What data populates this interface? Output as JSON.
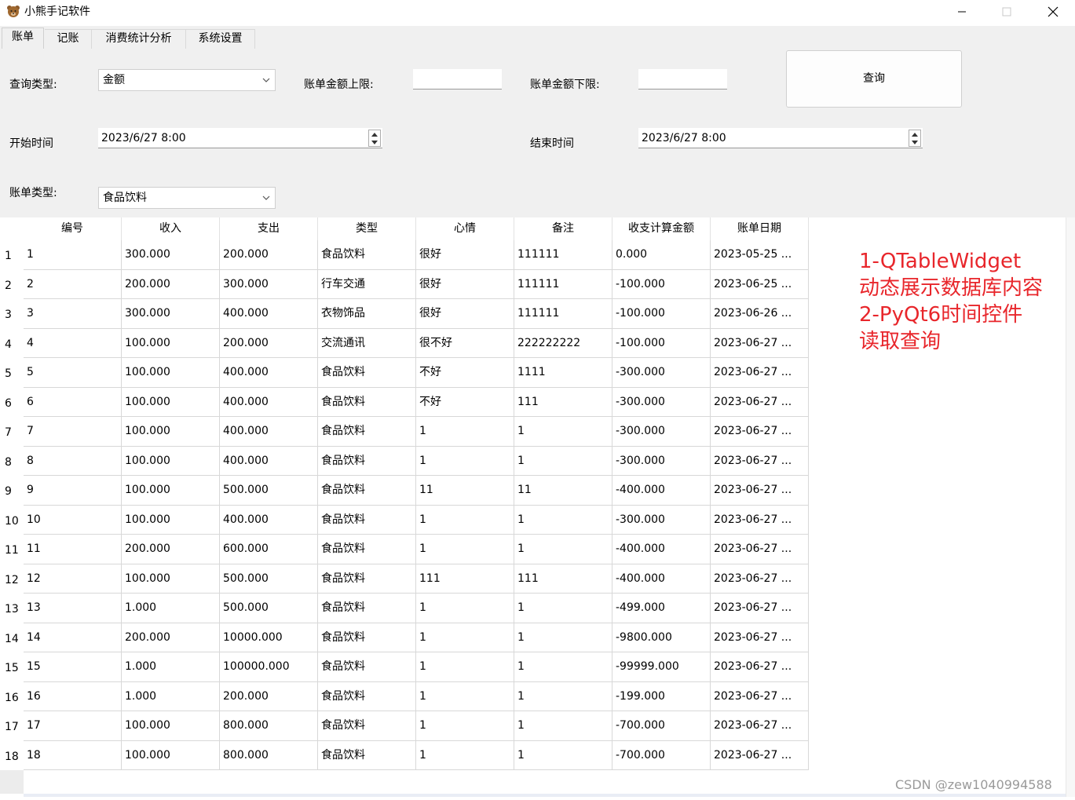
{
  "window": {
    "title": "小熊手记软件",
    "icon": "bear-icon"
  },
  "tabs": [
    {
      "label": "账单",
      "active": true
    },
    {
      "label": "记账",
      "active": false
    },
    {
      "label": "消费统计分析",
      "active": false
    },
    {
      "label": "系统设置",
      "active": false
    }
  ],
  "form": {
    "query_type_label": "查询类型:",
    "query_type_value": "金额",
    "amount_upper_label": "账单金额上限:",
    "amount_upper_value": "",
    "amount_lower_label": "账单金额下限:",
    "amount_lower_value": "",
    "query_button": "查询",
    "start_time_label": "开始时间",
    "start_time_value": "2023/6/27 8:00",
    "end_time_label": "结束时间",
    "end_time_value": "2023/6/27 8:00",
    "bill_type_label": "账单类型:",
    "bill_type_value": "食品饮料"
  },
  "table": {
    "columns": [
      "编号",
      "收入",
      "支出",
      "类型",
      "心情",
      "备注",
      "收支计算金额",
      "账单日期"
    ],
    "rows": [
      [
        "1",
        "1",
        "300.000",
        "200.000",
        "食品饮料",
        "很好",
        "111111",
        "0.000",
        "2023-05-25 ..."
      ],
      [
        "2",
        "2",
        "200.000",
        "300.000",
        "行车交通",
        "很好",
        "111111",
        "-100.000",
        "2023-06-25 ..."
      ],
      [
        "3",
        "3",
        "300.000",
        "400.000",
        "衣物饰品",
        "很好",
        "111111",
        "-100.000",
        "2023-06-26 ..."
      ],
      [
        "4",
        "4",
        "100.000",
        "200.000",
        "交流通讯",
        "很不好",
        "222222222",
        "-100.000",
        "2023-06-27 ..."
      ],
      [
        "5",
        "5",
        "100.000",
        "400.000",
        "食品饮料",
        "不好",
        "1111",
        "-300.000",
        "2023-06-27 ..."
      ],
      [
        "6",
        "6",
        "100.000",
        "400.000",
        "食品饮料",
        "不好",
        "111",
        "-300.000",
        "2023-06-27 ..."
      ],
      [
        "7",
        "7",
        "100.000",
        "400.000",
        "食品饮料",
        "1",
        "1",
        "-300.000",
        "2023-06-27 ..."
      ],
      [
        "8",
        "8",
        "100.000",
        "400.000",
        "食品饮料",
        "1",
        "1",
        "-300.000",
        "2023-06-27 ..."
      ],
      [
        "9",
        "9",
        "100.000",
        "500.000",
        "食品饮料",
        "11",
        "11",
        "-400.000",
        "2023-06-27 ..."
      ],
      [
        "10",
        "10",
        "100.000",
        "400.000",
        "食品饮料",
        "1",
        "1",
        "-300.000",
        "2023-06-27 ..."
      ],
      [
        "11",
        "11",
        "200.000",
        "600.000",
        "食品饮料",
        "1",
        "1",
        "-400.000",
        "2023-06-27 ..."
      ],
      [
        "12",
        "12",
        "100.000",
        "500.000",
        "食品饮料",
        "111",
        "111",
        "-400.000",
        "2023-06-27 ..."
      ],
      [
        "13",
        "13",
        "1.000",
        "500.000",
        "食品饮料",
        "1",
        "1",
        "-499.000",
        "2023-06-27 ..."
      ],
      [
        "14",
        "14",
        "200.000",
        "10000.000",
        "食品饮料",
        "1",
        "1",
        "-9800.000",
        "2023-06-27 ..."
      ],
      [
        "15",
        "15",
        "1.000",
        "100000.000",
        "食品饮料",
        "1",
        "1",
        "-99999.000",
        "2023-06-27 ..."
      ],
      [
        "16",
        "16",
        "1.000",
        "200.000",
        "食品饮料",
        "1",
        "1",
        "-199.000",
        "2023-06-27 ..."
      ],
      [
        "17",
        "17",
        "100.000",
        "800.000",
        "食品饮料",
        "1",
        "1",
        "-700.000",
        "2023-06-27 ..."
      ],
      [
        "18",
        "18",
        "100.000",
        "800.000",
        "食品饮料",
        "1",
        "1",
        "-700.000",
        "2023-06-27 ..."
      ]
    ]
  },
  "annotation": {
    "line1": "1-QTableWidget",
    "line2": "动态展示数据库内容",
    "line3": "2-PyQt6时间控件",
    "line4": "读取查询",
    "color": "#e8262b"
  },
  "watermark": "CSDN @zew1040994588"
}
